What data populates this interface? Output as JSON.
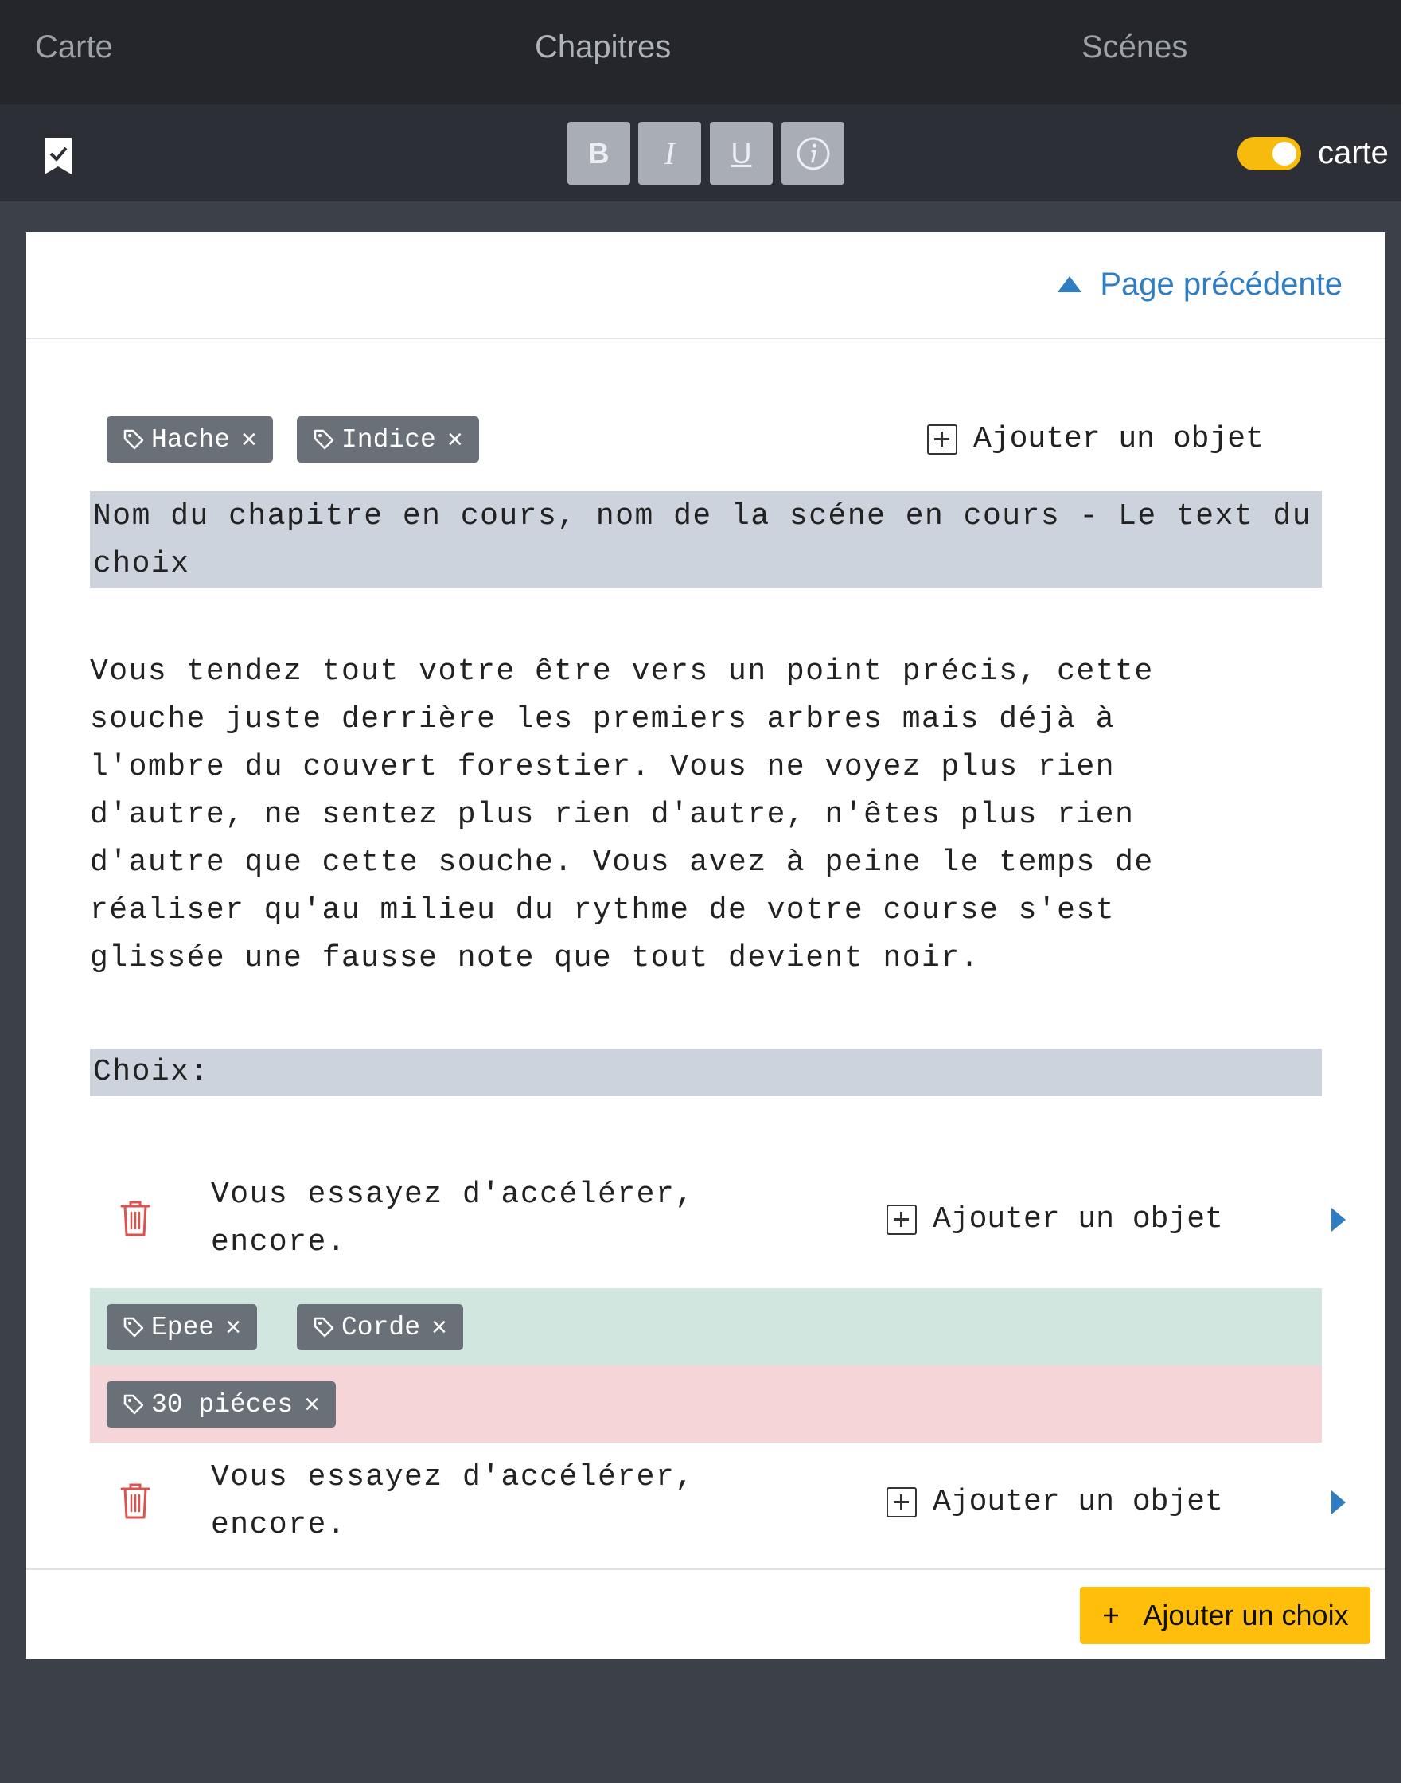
{
  "nav": {
    "tabs": [
      "Carte",
      "Chapitres",
      "Scénes"
    ]
  },
  "toolbar": {
    "bold_label": "B",
    "italic_label": "I",
    "underline_label": "U",
    "toggle_label": "carte",
    "toggle_on": true,
    "toggle_color": "#f6bb0d"
  },
  "panel": {
    "prev_page_label": "Page précédente",
    "tags": [
      "Hache",
      "Indice"
    ],
    "add_object_label": "Ajouter un objet",
    "title": "Nom du chapitre en cours, nom de la scéne en cours - Le text du choix",
    "body_lines": [
      "Vous tendez tout votre être vers un point précis, cette",
      "souche juste derrière les premiers arbres mais déjà à",
      "l'ombre du couvert forestier. Vous ne voyez plus rien",
      "d'autre, ne sentez plus rien d'autre, n'êtes plus rien",
      "d'autre que cette souche. Vous avez à peine le temps de",
      "réaliser qu'au milieu du rythme de votre course s'est",
      "glissée une fausse note que tout devient noir."
    ],
    "choices_label": "Choix:",
    "choices": [
      {
        "text": "Vous essayez d'accélérer, encore.",
        "add_object_label": "Ajouter un objet",
        "gain_tags": [
          "Epee",
          "Corde"
        ],
        "loss_tags": [
          "30 piéces"
        ]
      },
      {
        "text": "Vous essayez d'accélérer, encore.",
        "add_object_label": "Ajouter un objet"
      }
    ],
    "add_choice_label": "Ajouter un choix"
  },
  "colors": {
    "accent_link": "#2f7dc2",
    "accent_button": "#ffbe0b",
    "delete_icon": "#d9534f",
    "gain_band": "#d1e6de",
    "loss_band": "#f6d5d9"
  },
  "icons": {
    "toolbar_left": "bookmark-check-icon",
    "prev_page": "triangle-up-icon",
    "tag": "tag-icon",
    "add_object": "plus-square-icon",
    "delete": "trash-icon",
    "goto": "play-arrow-icon",
    "info": "info-circle-icon"
  }
}
